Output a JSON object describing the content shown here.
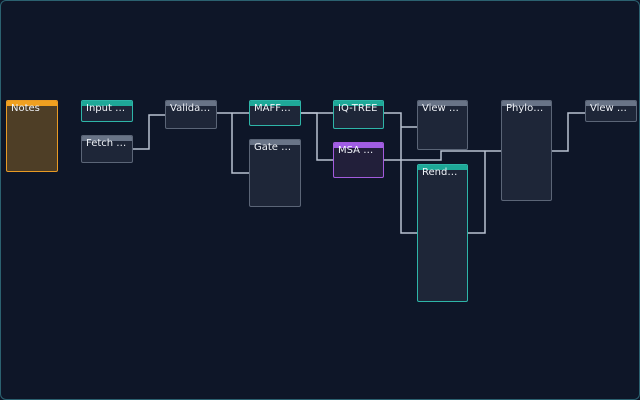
{
  "workflow": {
    "nodes": {
      "notes": "Notes",
      "input_s": "Input S...",
      "fetch_n": "Fetch N...",
      "validat": "Validat...",
      "mafft_a": "MAFFT A...",
      "gate_va": "Gate Va...",
      "iq_tree": "IQ-TREE",
      "msa_view": "MSA View",
      "view_al": "View Al...",
      "render": "Render ...",
      "phyloge": "Phyloge...",
      "view_ph": "View Ph..."
    }
  },
  "colors": {
    "canvas_background": "#0e1628",
    "canvas_border": "#2b6170",
    "node_default_header": "#697487",
    "node_teal_header": "#1ea898",
    "node_purple_header": "#a05ee4",
    "notes_header": "#f0a020",
    "edge": "#b9c2d1"
  }
}
